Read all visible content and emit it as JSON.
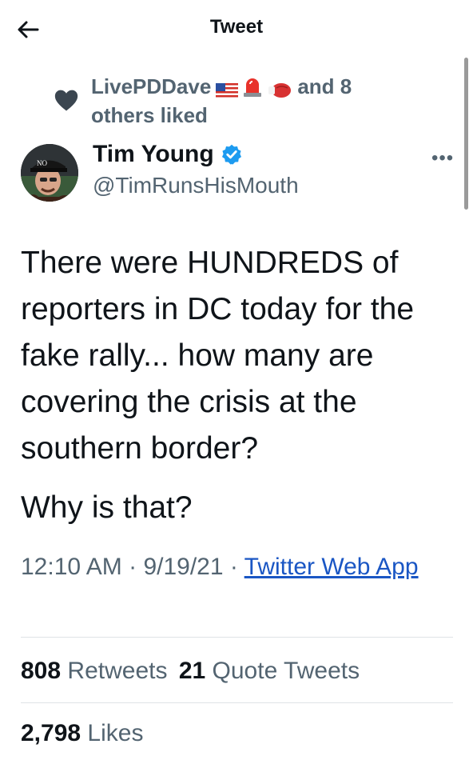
{
  "header": {
    "title": "Tweet"
  },
  "social_context": {
    "liker": "LivePDDave",
    "suffix_line1": "and 8",
    "suffix_line2": "others liked",
    "emojis": [
      "us-flag-emoji",
      "siren-emoji",
      "boxing-glove-emoji"
    ]
  },
  "author": {
    "name": "Tim Young",
    "handle": "@TimRunsHisMouth",
    "avatar_hat_text": "NO",
    "verified": true
  },
  "tweet": {
    "paragraph1": "There were HUNDREDS of reporters in DC today for the fake rally... how many are covering the crisis at the southern border?",
    "paragraph2": "Why is that?"
  },
  "meta": {
    "time": "12:10 AM",
    "date": "9/19/21",
    "source": "Twitter Web App"
  },
  "stats": {
    "retweets_count": "808",
    "retweets_label": "Retweets",
    "quotes_count": "21",
    "quotes_label": "Quote Tweets",
    "likes_count": "2,798",
    "likes_label": "Likes"
  },
  "colors": {
    "link": "#1a56c4",
    "verified": "#1d9bf0",
    "secondary_text": "#536471"
  }
}
